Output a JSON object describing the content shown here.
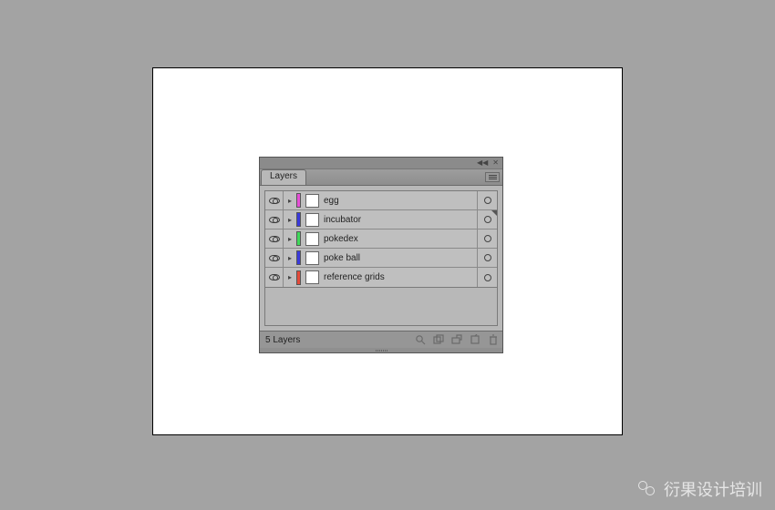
{
  "panel": {
    "tab_label": "Layers",
    "footer_count_label": "5 Layers"
  },
  "layers": [
    {
      "name": "egg",
      "color": "#e64fd6",
      "selected_marker": false
    },
    {
      "name": "incubator",
      "color": "#3a3adc",
      "selected_marker": true
    },
    {
      "name": "pokedex",
      "color": "#3fd85a",
      "selected_marker": false
    },
    {
      "name": "poke ball",
      "color": "#3a3adc",
      "selected_marker": false
    },
    {
      "name": "reference grids",
      "color": "#e44a3a",
      "selected_marker": false
    }
  ],
  "watermark": {
    "text": "衍果设计培训"
  }
}
